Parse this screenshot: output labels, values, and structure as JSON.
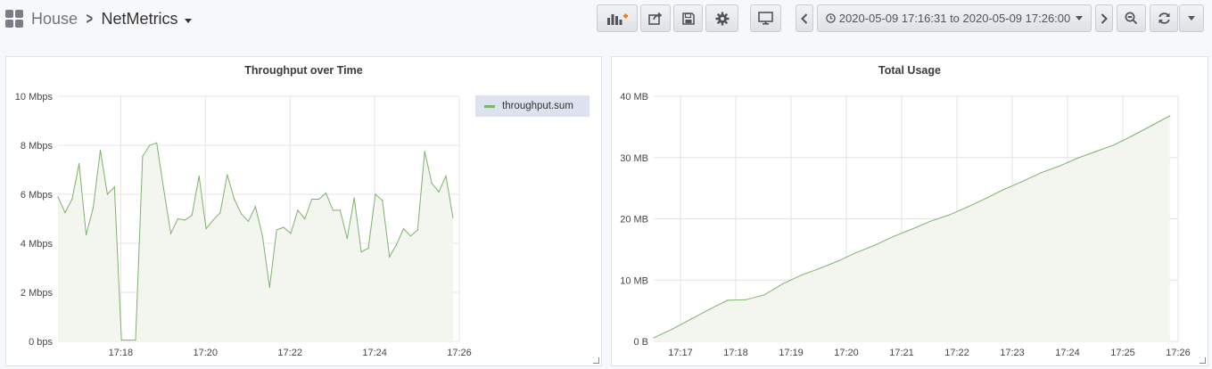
{
  "header": {
    "folder": "House",
    "dashboard_title": "NetMetrics",
    "time_range": "2020-05-09 17:16:31 to 2020-05-09 17:26:00",
    "icons": [
      "add-panel-icon",
      "share-icon",
      "save-icon",
      "settings-icon",
      "tv-mode-icon",
      "chevron-left-icon",
      "clock-icon",
      "chevron-right-icon",
      "zoom-out-icon",
      "refresh-icon",
      "caret-down-icon"
    ]
  },
  "colors": {
    "series": "#7eb26d",
    "fill": "#f3f6ee",
    "grid": "#e4e4e4"
  },
  "panels": [
    {
      "title": "Throughput over Time",
      "legend": [
        "throughput.sum"
      ],
      "chart_data": {
        "type": "area",
        "title": "Throughput over Time",
        "x_ticks": [
          "17:18",
          "17:20",
          "17:22",
          "17:24",
          "17:26"
        ],
        "y_ticks": [
          "0 bps",
          "2 Mbps",
          "4 Mbps",
          "6 Mbps",
          "8 Mbps",
          "10 Mbps"
        ],
        "ylim": [
          0,
          10
        ],
        "xlim": [
          "17:16:31",
          "17:26:00"
        ],
        "legend_position": "right",
        "grid": true,
        "series": [
          {
            "name": "throughput.sum",
            "unit": "Mbps",
            "points": [
              [
                "17:16:31",
                5.9
              ],
              [
                "17:16:41",
                5.25
              ],
              [
                "17:16:51",
                5.8
              ],
              [
                "17:17:01",
                7.25
              ],
              [
                "17:17:11",
                4.35
              ],
              [
                "17:17:21",
                5.45
              ],
              [
                "17:17:31",
                7.8
              ],
              [
                "17:17:41",
                6.0
              ],
              [
                "17:17:51",
                6.3
              ],
              [
                "17:18:01",
                0.05
              ],
              [
                "17:18:11",
                0.05
              ],
              [
                "17:18:21",
                0.05
              ],
              [
                "17:18:31",
                7.55
              ],
              [
                "17:18:41",
                8.0
              ],
              [
                "17:18:51",
                8.1
              ],
              [
                "17:19:01",
                6.2
              ],
              [
                "17:19:11",
                4.4
              ],
              [
                "17:19:21",
                5.0
              ],
              [
                "17:19:31",
                4.95
              ],
              [
                "17:19:41",
                5.15
              ],
              [
                "17:19:51",
                6.75
              ],
              [
                "17:20:01",
                4.6
              ],
              [
                "17:20:11",
                4.95
              ],
              [
                "17:20:21",
                5.25
              ],
              [
                "17:20:31",
                6.8
              ],
              [
                "17:20:41",
                5.8
              ],
              [
                "17:20:51",
                5.2
              ],
              [
                "17:21:01",
                4.9
              ],
              [
                "17:21:11",
                5.5
              ],
              [
                "17:21:21",
                4.3
              ],
              [
                "17:21:31",
                2.2
              ],
              [
                "17:21:41",
                4.55
              ],
              [
                "17:21:51",
                4.65
              ],
              [
                "17:22:01",
                4.4
              ],
              [
                "17:22:11",
                5.35
              ],
              [
                "17:22:21",
                5.0
              ],
              [
                "17:22:31",
                5.8
              ],
              [
                "17:22:41",
                5.8
              ],
              [
                "17:22:51",
                6.05
              ],
              [
                "17:23:01",
                5.35
              ],
              [
                "17:23:11",
                5.35
              ],
              [
                "17:23:21",
                4.2
              ],
              [
                "17:23:31",
                5.85
              ],
              [
                "17:23:41",
                3.65
              ],
              [
                "17:23:51",
                3.8
              ],
              [
                "17:24:01",
                6.0
              ],
              [
                "17:24:11",
                5.75
              ],
              [
                "17:24:21",
                3.45
              ],
              [
                "17:24:31",
                3.95
              ],
              [
                "17:24:41",
                4.6
              ],
              [
                "17:24:51",
                4.3
              ],
              [
                "17:25:01",
                4.55
              ],
              [
                "17:25:11",
                7.75
              ],
              [
                "17:25:21",
                6.45
              ],
              [
                "17:25:31",
                6.1
              ],
              [
                "17:25:41",
                6.75
              ],
              [
                "17:25:51",
                5.05
              ]
            ]
          }
        ]
      }
    },
    {
      "title": "Total Usage",
      "chart_data": {
        "type": "area",
        "title": "Total Usage",
        "x_ticks": [
          "17:17",
          "17:18",
          "17:19",
          "17:20",
          "17:21",
          "17:22",
          "17:23",
          "17:24",
          "17:25",
          "17:26"
        ],
        "y_ticks": [
          "0 B",
          "10 MB",
          "20 MB",
          "30 MB",
          "40 MB"
        ],
        "ylim": [
          0,
          40
        ],
        "xlim": [
          "17:16:31",
          "17:26:00"
        ],
        "legend_position": "none",
        "grid": true,
        "series": [
          {
            "unit": "MB",
            "points": [
              [
                "17:16:31",
                0.6
              ],
              [
                "17:16:51",
                2.0
              ],
              [
                "17:17:11",
                3.6
              ],
              [
                "17:17:31",
                5.2
              ],
              [
                "17:17:51",
                6.7
              ],
              [
                "17:18:11",
                6.8
              ],
              [
                "17:18:31",
                7.6
              ],
              [
                "17:18:51",
                9.4
              ],
              [
                "17:19:11",
                10.8
              ],
              [
                "17:19:31",
                11.9
              ],
              [
                "17:19:51",
                13.1
              ],
              [
                "17:20:11",
                14.5
              ],
              [
                "17:20:31",
                15.7
              ],
              [
                "17:20:51",
                17.1
              ],
              [
                "17:21:11",
                18.3
              ],
              [
                "17:21:31",
                19.6
              ],
              [
                "17:21:51",
                20.6
              ],
              [
                "17:22:11",
                21.9
              ],
              [
                "17:22:31",
                23.3
              ],
              [
                "17:22:51",
                24.8
              ],
              [
                "17:23:11",
                26.1
              ],
              [
                "17:23:31",
                27.5
              ],
              [
                "17:23:51",
                28.6
              ],
              [
                "17:24:11",
                29.9
              ],
              [
                "17:24:31",
                31.0
              ],
              [
                "17:24:51",
                32.1
              ],
              [
                "17:25:11",
                33.6
              ],
              [
                "17:25:31",
                35.2
              ],
              [
                "17:25:51",
                36.8
              ]
            ]
          }
        ]
      }
    }
  ]
}
